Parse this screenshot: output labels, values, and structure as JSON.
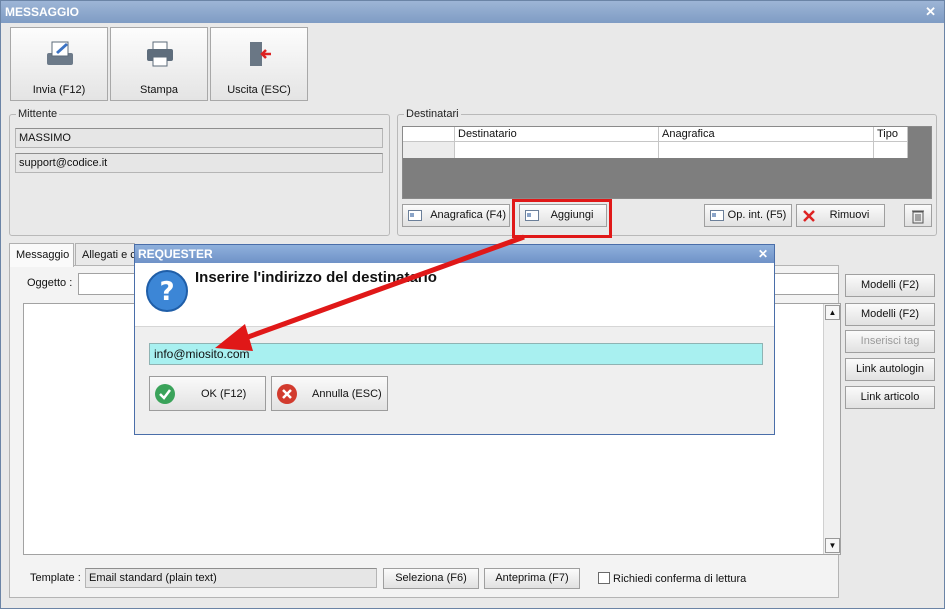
{
  "window": {
    "title": "MESSAGGIO",
    "close_glyph": "✕"
  },
  "toolbar": {
    "send_label": "Invia (F12)",
    "print_label": "Stampa",
    "exit_label": "Uscita (ESC)"
  },
  "sender": {
    "legend": "Mittente",
    "name": "MASSIMO",
    "email": "support@codice.it"
  },
  "recipients": {
    "legend": "Destinatari",
    "columns": [
      "Destinatario",
      "Anagrafica",
      "Tipo"
    ],
    "buttons": {
      "anagrafica": "Anagrafica (F4)",
      "aggiungi": "Aggiungi",
      "op_int": "Op. int. (F5)",
      "rimuovi": "Rimuovi"
    }
  },
  "tabs": {
    "messaggio": "Messaggio",
    "allegati": "Allegati e c"
  },
  "subject": {
    "label": "Oggetto :",
    "value": ""
  },
  "side_buttons": {
    "modelli_1": "Modelli (F2)",
    "modelli_2": "Modelli (F2)",
    "inserisci_tag": "Inserisci tag",
    "link_autologin": "Link autologin",
    "link_articolo": "Link articolo"
  },
  "footer": {
    "template_label": "Template :",
    "template_value": "Email standard (plain text)",
    "seleziona": "Seleziona (F6)",
    "anteprima": "Anteprima (F7)",
    "read_receipt": "Richiedi conferma di lettura"
  },
  "dialog": {
    "title": "REQUESTER",
    "close_glyph": "✕",
    "message": "Inserire l'indirizzo del destinatario",
    "input_value": "info@miosito.com",
    "ok_label": "OK (F12)",
    "cancel_label": "Annulla (ESC)"
  },
  "colors": {
    "title_bar": "#7f9cc4",
    "highlight_red": "#e01818",
    "input_highlight": "#a8f0f0",
    "ok_green": "#3aa35a",
    "cancel_red": "#d23b2e"
  }
}
